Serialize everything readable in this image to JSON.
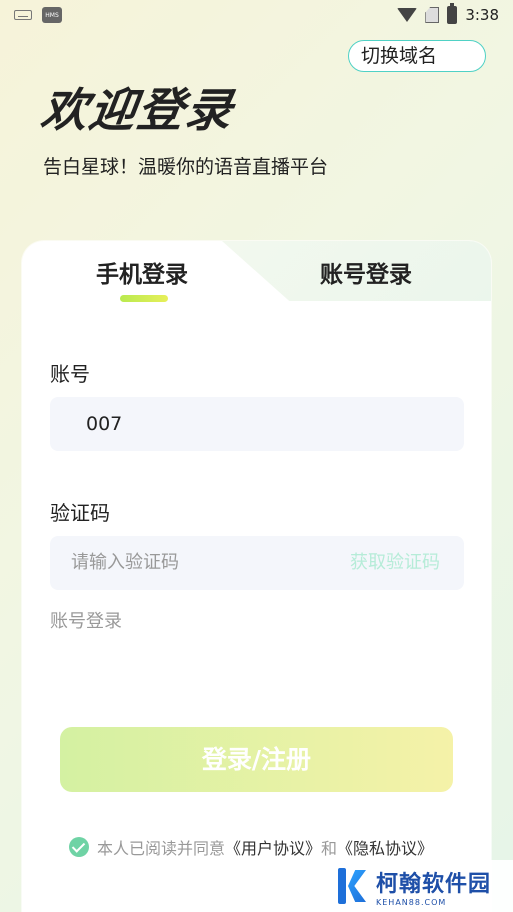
{
  "status_bar": {
    "left_icons": [
      "keyboard-icon",
      "hms-icon"
    ],
    "hms_label": "HMS",
    "right_icons": [
      "wifi-icon",
      "sim-icon",
      "battery-icon"
    ],
    "time": "3:38"
  },
  "header": {
    "domain_button": "切换域名",
    "title": "欢迎登录",
    "subtitle": "告白星球！温暖你的语音直播平台"
  },
  "tabs": [
    {
      "label": "手机登录",
      "active": true
    },
    {
      "label": "账号登录",
      "active": false
    }
  ],
  "form": {
    "account_label": "账号",
    "account_value": "007",
    "code_label": "验证码",
    "code_placeholder": "请输入验证码",
    "get_code": "获取验证码",
    "switch_link": "账号登录"
  },
  "login_button": "登录/注册",
  "agreement": {
    "prefix": "本人已阅读并同意",
    "user_agreement": "《用户协议》",
    "and": "和",
    "privacy_agreement": "《隐私协议》",
    "checked": true
  },
  "watermark": {
    "name": "柯翰软件园",
    "domain": "KEHAN88.COM"
  },
  "colors": {
    "accent": "#4fd1c5",
    "tab_indicator": "#c8ec55",
    "check": "#6fd3a5",
    "get_code": "#b6ecd8"
  }
}
